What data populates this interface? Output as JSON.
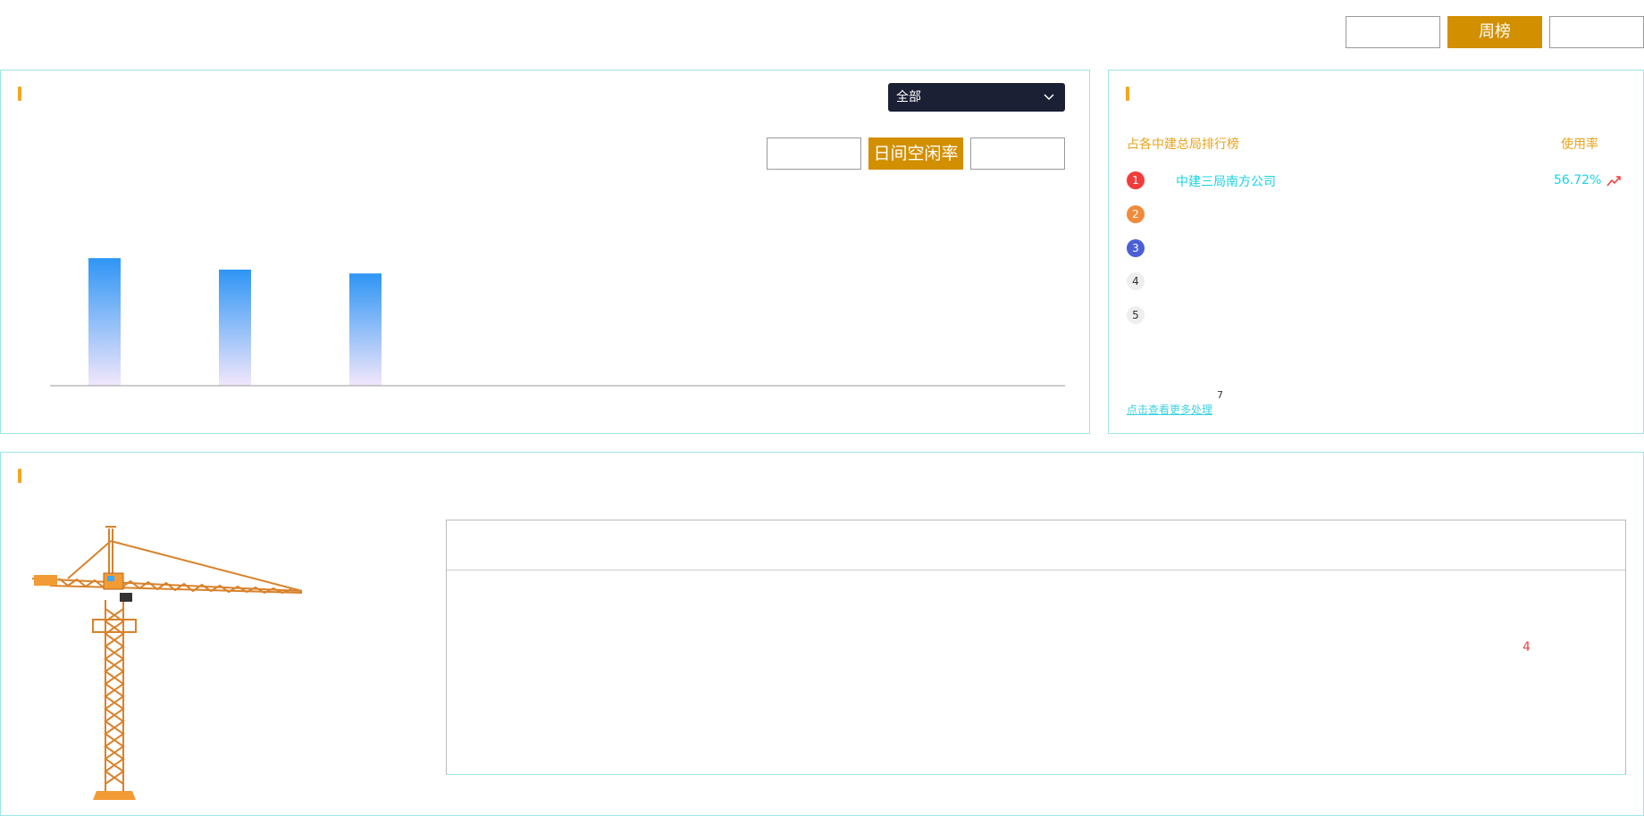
{
  "top_tabs": [
    {
      "label": "",
      "active": false
    },
    {
      "label": "周榜",
      "active": true
    },
    {
      "label": "",
      "active": false
    }
  ],
  "usage_panel": {
    "title": "",
    "dropdown": {
      "selected": "全部",
      "icon": "chevron-down-icon"
    },
    "sub_tabs": [
      {
        "label": "",
        "active": false
      },
      {
        "label": "日间空闲率",
        "active": true
      },
      {
        "label": "",
        "active": false
      }
    ]
  },
  "chart_data": {
    "type": "bar",
    "categories": [
      "",
      "",
      ""
    ],
    "series": [
      {
        "values": [
          100,
          91,
          88
        ]
      }
    ],
    "ylim": [
      0,
      140
    ],
    "grid": false,
    "colors": {
      "bar_top": "#2e95f5",
      "bar_bottom": "#f2e7fb"
    }
  },
  "ranking_panel": {
    "title": "",
    "header_left": "占各中建总局排行榜",
    "header_right": "使用率",
    "items": [
      {
        "rank": "1",
        "name": "中建三局南方公司",
        "rate": "56.72%",
        "trend": "trend-up-icon",
        "badge_color": "#f23c3c",
        "text_color": "#ffffff"
      },
      {
        "rank": "2",
        "name": "",
        "rate": "",
        "badge_color": "#f08b3c",
        "text_color": "#ffffff"
      },
      {
        "rank": "3",
        "name": "",
        "rate": "",
        "badge_color": "#4a5fd6",
        "text_color": "#ffffff"
      },
      {
        "rank": "4",
        "name": "",
        "rate": "",
        "badge_color": "#eeeeee",
        "text_color": "#333333"
      },
      {
        "rank": "5",
        "name": "",
        "rate": "",
        "badge_color": "#eeeeee",
        "text_color": "#333333"
      }
    ],
    "more_link": "点击查看更多处理",
    "more_count": "7"
  },
  "device_panel": {
    "title": "",
    "image": "tower-crane-illustration",
    "table_value": "4"
  }
}
